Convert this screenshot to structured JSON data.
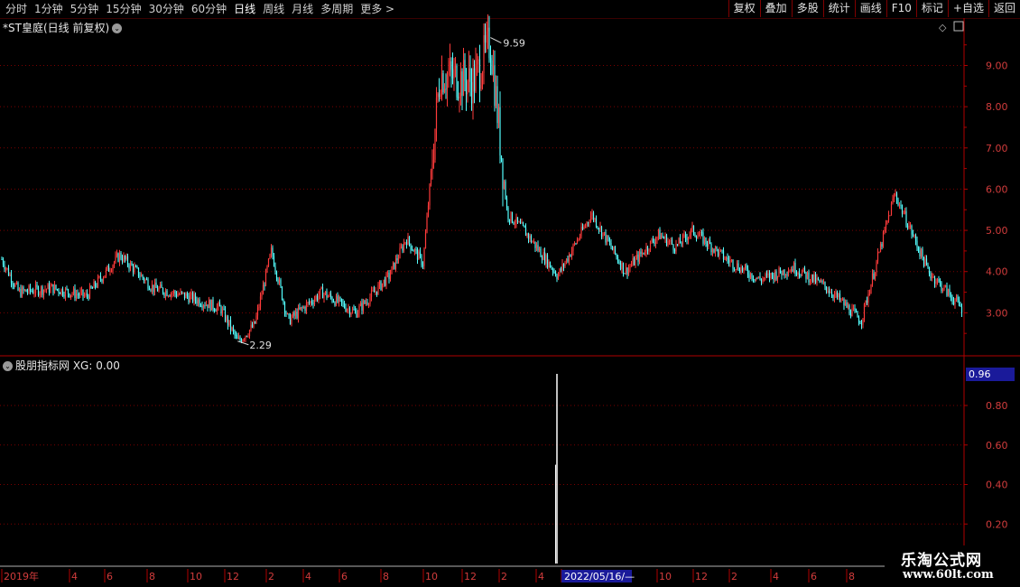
{
  "toolbar": {
    "period_tabs": [
      {
        "label": "分时",
        "active": false
      },
      {
        "label": "1分钟",
        "active": false
      },
      {
        "label": "5分钟",
        "active": false
      },
      {
        "label": "15分钟",
        "active": false
      },
      {
        "label": "30分钟",
        "active": false
      },
      {
        "label": "60分钟",
        "active": false
      },
      {
        "label": "日线",
        "active": true
      },
      {
        "label": "周线",
        "active": false
      },
      {
        "label": "月线",
        "active": false
      },
      {
        "label": "多周期",
        "active": false
      },
      {
        "label": "更多",
        "active": false
      }
    ],
    "tools": [
      "复权",
      "叠加",
      "多股",
      "统计",
      "画线",
      "F10",
      "标记",
      "+自选",
      "返回"
    ]
  },
  "main_chart": {
    "title": "*ST皇庭(日线 前复权)",
    "max_label": "9.59",
    "min_label": "2.29",
    "y_ticks": [
      "9.00",
      "8.00",
      "7.00",
      "6.00",
      "5.00",
      "4.00",
      "3.00"
    ]
  },
  "indicator": {
    "title": "股朋指标网 XG: 0.00",
    "current_value": "0.96",
    "y_ticks": [
      "0.80",
      "0.60",
      "0.40",
      "0.20"
    ]
  },
  "time_axis": {
    "labels": [
      "2019年",
      "4",
      "6",
      "8",
      "10",
      "12",
      "2",
      "4",
      "6",
      "8",
      "10",
      "12",
      "2",
      "4",
      "2022/05/16/—",
      "10",
      "12",
      "2",
      "4",
      "6",
      "8"
    ],
    "highlight": "2022/05/16/—"
  },
  "watermark": {
    "line1": "乐淘公式网",
    "line2": "www.60lt.com"
  },
  "colors": {
    "up": "#ff3b3b",
    "down": "#54ffff",
    "grid": "#7a0000",
    "axis": "#b00000",
    "tick_text": "#d23c3c",
    "highlight_bg": "#1a1a9a"
  },
  "chart_data": {
    "type": "candlestick",
    "approx_close_path": {
      "x": [
        "2019-01",
        "2019-02",
        "2019-04",
        "2019-06",
        "2019-08",
        "2019-10",
        "2019-12",
        "2020-02",
        "2020-03",
        "2020-04",
        "2020-05",
        "2020-06",
        "2020-08",
        "2020-10",
        "2020-12",
        "2021-01",
        "2021-02",
        "2021-03",
        "2021-05",
        "2021-06",
        "2021-07",
        "2021-08",
        "2021-10",
        "2021-12",
        "2022-02",
        "2022-04",
        "2022-05",
        "2022-06",
        "2022-08",
        "2022-10",
        "2022-12",
        "2023-02",
        "2023-04",
        "2023-06",
        "2023-08",
        "2023-10"
      ],
      "y": [
        4.3,
        3.5,
        3.6,
        3.4,
        4.4,
        3.6,
        3.4,
        3.1,
        2.3,
        2.7,
        4.5,
        2.8,
        3.5,
        3.0,
        3.9,
        4.8,
        4.2,
        8.8,
        8.6,
        9.59,
        5.4,
        5.0,
        3.9,
        5.4,
        4.0,
        4.9,
        4.6,
        5.0,
        4.3,
        3.8,
        4.1,
        3.6,
        2.8,
        5.9,
        4.0,
        3.1
      ]
    },
    "max": 9.59,
    "min": 2.29,
    "ylim": [
      2.0,
      9.8
    ],
    "indicator_spike": {
      "date": "2022/05/16",
      "value": 0.96
    },
    "indicator_ylim": [
      0.0,
      0.96
    ]
  }
}
